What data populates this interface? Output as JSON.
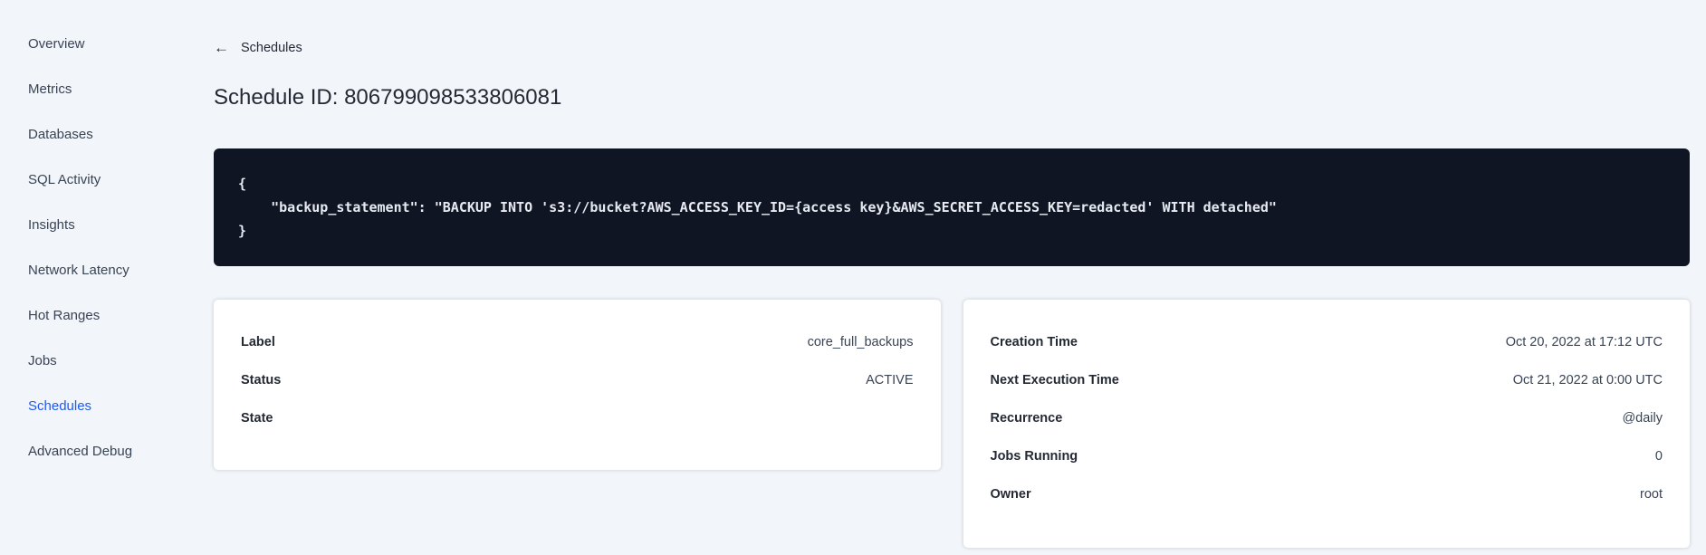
{
  "colors": {
    "accent_blue": "#1F5AF5",
    "page_background": "#F2F5F9",
    "code_background": "#0F1523",
    "code_text": "#E7EAF1",
    "card_background": "#FFFFFF",
    "text_primary": "#242A35",
    "text_secondary": "#394455"
  },
  "sidebar": {
    "items": [
      {
        "label": "Overview",
        "active": false
      },
      {
        "label": "Metrics",
        "active": false
      },
      {
        "label": "Databases",
        "active": false
      },
      {
        "label": "SQL Activity",
        "active": false
      },
      {
        "label": "Insights",
        "active": false
      },
      {
        "label": "Network Latency",
        "active": false
      },
      {
        "label": "Hot Ranges",
        "active": false
      },
      {
        "label": "Jobs",
        "active": false
      },
      {
        "label": "Schedules",
        "active": true
      },
      {
        "label": "Advanced Debug",
        "active": false
      }
    ]
  },
  "header": {
    "back_icon": "←",
    "back_label": "Schedules",
    "title": "Schedule ID: 806799098533806081"
  },
  "code_block": {
    "lines": [
      "{",
      "    \"backup_statement\": \"BACKUP INTO 's3://bucket?AWS_ACCESS_KEY_ID={access key}&AWS_SECRET_ACCESS_KEY=redacted' WITH detached\"",
      "}"
    ]
  },
  "details_card": {
    "rows": [
      {
        "label": "Label",
        "value": "core_full_backups"
      },
      {
        "label": "Status",
        "value": "ACTIVE"
      },
      {
        "label": "State",
        "value": ""
      }
    ]
  },
  "schedule_card": {
    "rows": [
      {
        "label": "Creation Time",
        "value": "Oct 20, 2022 at 17:12 UTC"
      },
      {
        "label": "Next Execution Time",
        "value": "Oct 21, 2022 at 0:00 UTC"
      },
      {
        "label": "Recurrence",
        "value": "@daily"
      },
      {
        "label": "Jobs Running",
        "value": "0"
      },
      {
        "label": "Owner",
        "value": "root"
      }
    ]
  }
}
